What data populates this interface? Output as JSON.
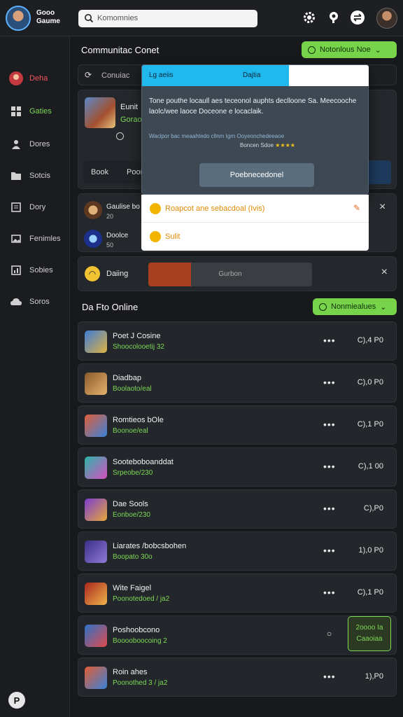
{
  "profile": {
    "name": "Gooo Gaume"
  },
  "search": {
    "text": "Komomnies"
  },
  "sidebar": {
    "items": [
      {
        "label": "Deha",
        "icon": "home-icon",
        "state": "active"
      },
      {
        "label": "Gaties",
        "icon": "grid-icon",
        "state": "green"
      },
      {
        "label": "Dores",
        "icon": "person-icon",
        "state": ""
      },
      {
        "label": "Sotcis",
        "icon": "folder-icon",
        "state": ""
      },
      {
        "label": "Dory",
        "icon": "document-icon",
        "state": ""
      },
      {
        "label": "Fenimles",
        "icon": "image-icon",
        "state": ""
      },
      {
        "label": "Sobies",
        "icon": "chart-icon",
        "state": ""
      },
      {
        "label": "Soros",
        "icon": "cloud-icon",
        "state": ""
      }
    ],
    "help": "P"
  },
  "main": {
    "title": "Communitac Conet",
    "top_pill": "Notonlous Noe",
    "filter_label": "Conuiac",
    "featured": {
      "title": "Eunit",
      "subtitle": "Gorao",
      "tab1": "Book",
      "tab2": "Poor"
    },
    "notif": [
      {
        "name": "Gaulise bo",
        "sub": "20"
      },
      {
        "name": "Doolce",
        "sub": "50"
      }
    ],
    "progress_row": {
      "label": "Daiing",
      "bar_text": "Gurbon",
      "progress": 0.26
    }
  },
  "tooltip": {
    "head_left": "Lg aeiis",
    "head_mid": "Dajtia",
    "body": "Tone pouthe locaull aes teceonol auphts declloone Sa. Meecooche laolc/wee laoce Doceone e locaclaik.",
    "meta": "Waclpor bac meaahtedo cllnm Igrn Ooyeonchedeeaoe",
    "rating_text": "Boncen Sdoe",
    "stars": "★★★★",
    "button": "Poebnecedonel"
  },
  "dropdown": {
    "item1": "Roapcot ane sebacdoal (Ivis)",
    "item2": "Sulit"
  },
  "online": {
    "title": "Da Fto Online",
    "pill": "Nonmiealues"
  },
  "games": [
    {
      "name": "Poet J Cosine",
      "status": "Shoocolooetij 32",
      "time": "C),4 P0"
    },
    {
      "name": "Diadbap",
      "status": "Boolaoto/eal",
      "time": "C),0 P0"
    },
    {
      "name": "Romtieos bOle",
      "status": "Boonoe/eal",
      "time": "C),1 P0"
    },
    {
      "name": "Sooteboboanddat",
      "status": "Srpeobe/230",
      "time": "C),1 00"
    },
    {
      "name": "Dae Sools",
      "status": "Eonboe/230",
      "time": "C),P0"
    },
    {
      "name": "Liarates /bobcsbohen",
      "status": "Boopato 30o",
      "time": "1),0 P0"
    },
    {
      "name": "Wite Faigel",
      "status": "Poonotedoed / ja2",
      "time": "C),1 P0"
    },
    {
      "name": "Poshoobcono",
      "status": "Booooboocoing 2",
      "time": ""
    },
    {
      "name": "Roin ahes",
      "status": "Poonothed 3 / ja2",
      "time": "1),P0"
    }
  ],
  "games_badge": {
    "line1": "2oooo Ia",
    "line2": "Caaoiaa"
  }
}
